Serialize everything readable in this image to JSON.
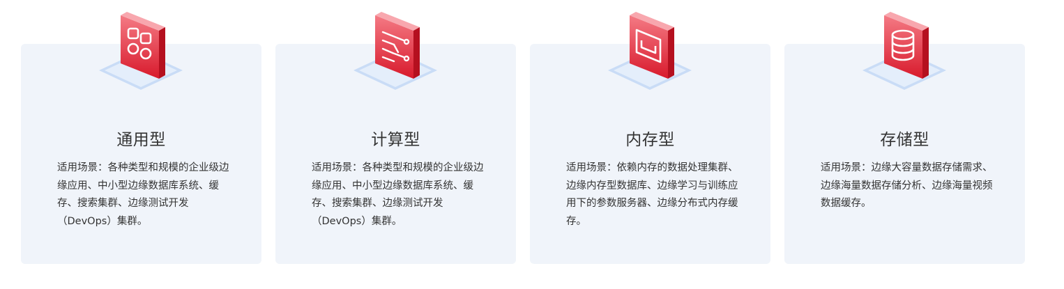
{
  "colors": {
    "card_bg": "#f0f4fa",
    "icon_red_top": "#f2707b",
    "icon_red_bottom": "#d9182a",
    "platform": "#cfe0f7",
    "text": "#333333"
  },
  "cards": [
    {
      "icon": "grid-apps-icon",
      "title": "通用型",
      "desc": "适用场景：各种类型和规模的企业级边缘应用、中小型边缘数据库系统、缓存、搜索集群、边缘测试开发（DevOps）集群。"
    },
    {
      "icon": "compute-flow-icon",
      "title": "计算型",
      "desc": "适用场景：各种类型和规模的企业级边缘应用、中小型边缘数据库系统、缓存、搜索集群、边缘测试开发（DevOps）集群。"
    },
    {
      "icon": "memory-card-icon",
      "title": "内存型",
      "desc": "适用场景：依赖内存的数据处理集群、边缘内存型数据库、边缘学习与训练应用下的参数服务器、边缘分布式内存缓存。"
    },
    {
      "icon": "database-storage-icon",
      "title": "存储型",
      "desc": "适用场景：边缘大容量数据存储需求、边缘海量数据存储分析、边缘海量视频数据缓存。"
    }
  ]
}
